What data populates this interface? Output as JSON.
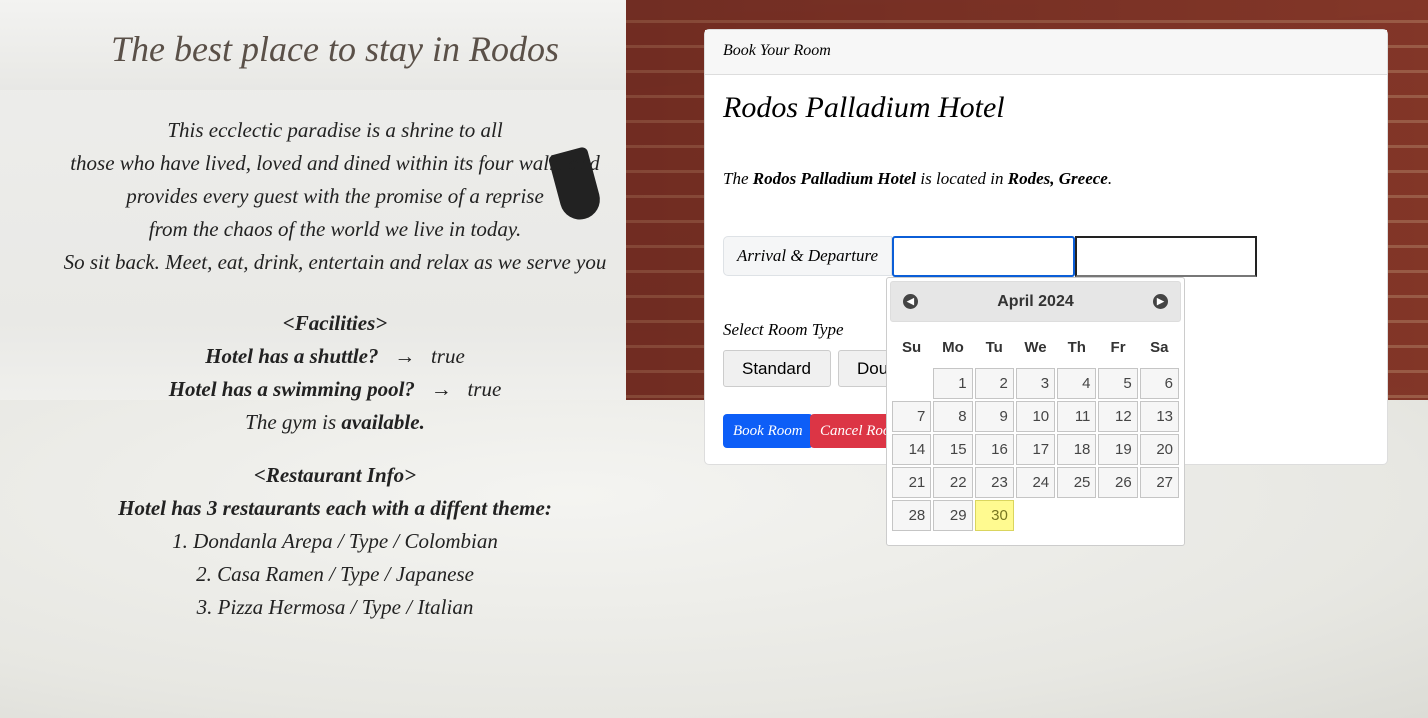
{
  "left": {
    "heading": "The best place to stay in Rodos",
    "intro": [
      "This ecclectic paradise is a shrine to all",
      "those who have lived, loved and dined within its four walls and",
      "provides every guest with the promise of a reprise",
      "from the chaos of the world we live in today.",
      "So sit back. Meet, eat, drink, entertain and relax as we serve you"
    ],
    "facilities_title": "<Facilities>",
    "facilities": [
      {
        "label": "Hotel has a shuttle?",
        "arrow": "→",
        "value": "true"
      },
      {
        "label": "Hotel has a swimming pool?",
        "arrow": "→",
        "value": "true"
      }
    ],
    "gym_pre": "The gym is ",
    "gym_value": "available.",
    "restaurant_title": "<Restaurant Info>",
    "restaurant_summary": "Hotel has 3 restaurants each with a diffent theme:",
    "restaurants": [
      "1. Dondanla Arepa / Type / Colombian",
      "2. Casa Ramen / Type / Japanese",
      "3. Pizza Hermosa / Type / Italian"
    ]
  },
  "card": {
    "header": "Book Your Room",
    "hotel_name": "Rodos Palladium Hotel",
    "loc_pre": "The ",
    "loc_hotel": "Rodos Palladium Hotel",
    "loc_mid": " is located in ",
    "loc_place": "Rodes, Greece",
    "loc_end": ".",
    "date_label": "Arrival & Departure",
    "arrival_value": "",
    "departure_value": "",
    "room_type_label": "Select Room Type",
    "room_types": [
      "Standard",
      "Dou"
    ],
    "book_label": "Book Room",
    "cancel_label": "Cancel Room"
  },
  "datepicker": {
    "month": "April 2024",
    "days": [
      "Su",
      "Mo",
      "Tu",
      "We",
      "Th",
      "Fr",
      "Sa"
    ],
    "first_weekday": 1,
    "count": 30,
    "highlighted": 30
  },
  "colors": {
    "primary": "#0d5ef7",
    "danger": "#dc3545",
    "highlight": "#fffa90"
  }
}
